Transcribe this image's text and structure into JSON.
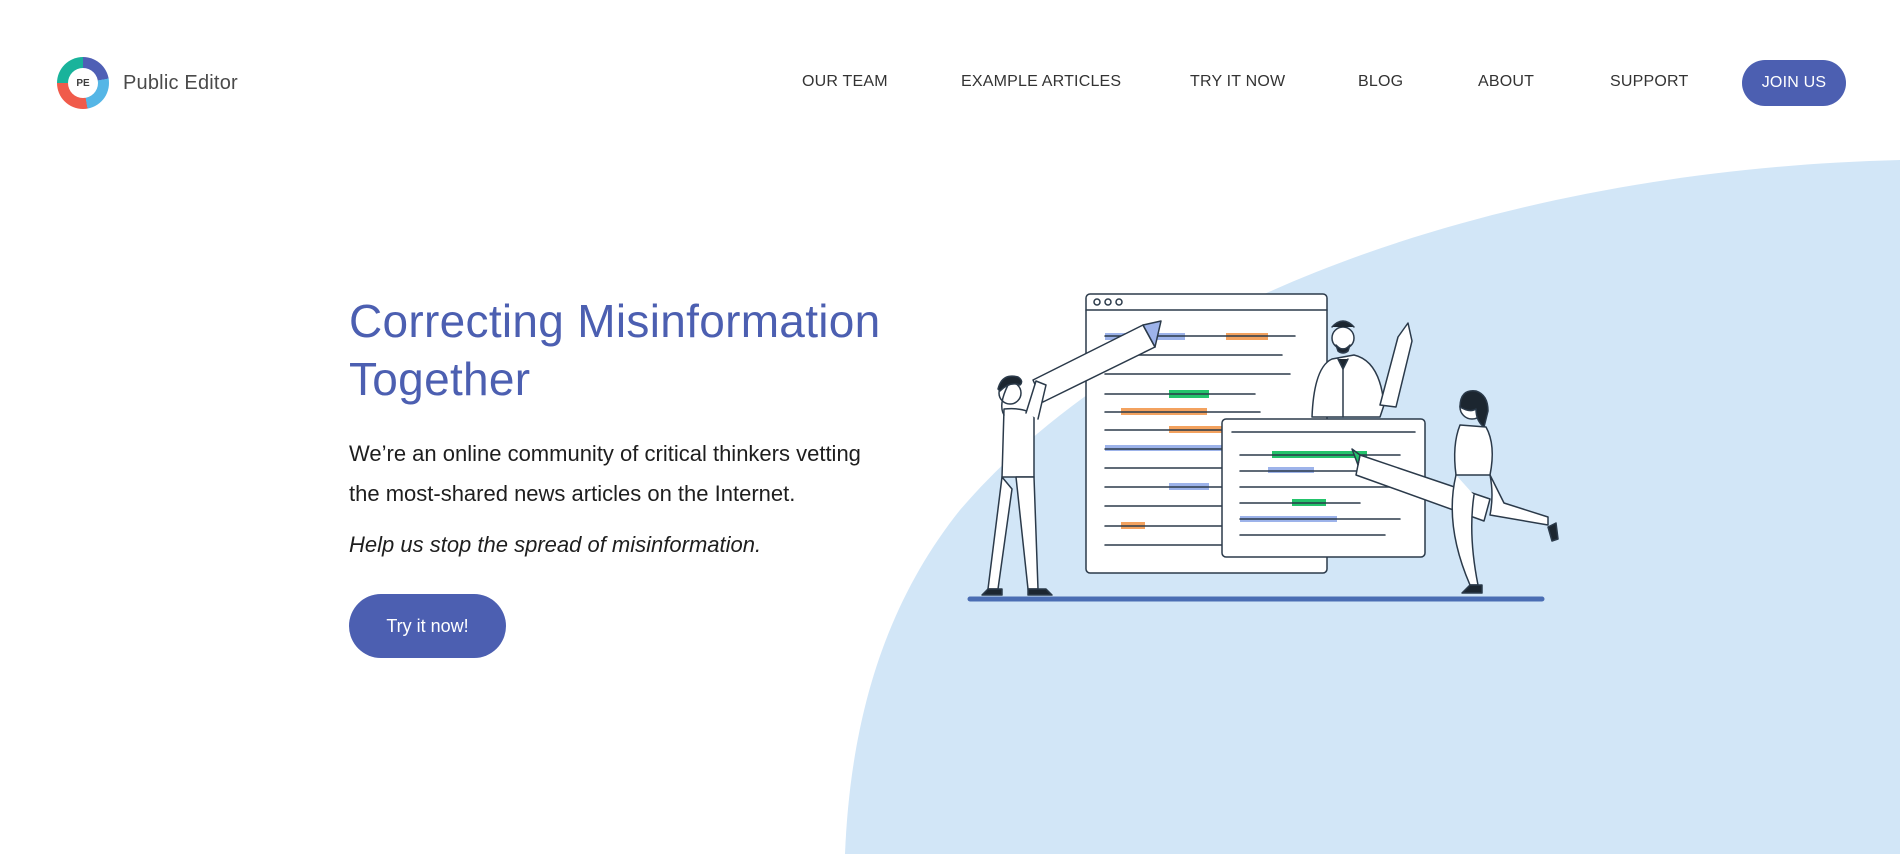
{
  "brand": {
    "logo_initials": "PE",
    "name": "Public Editor"
  },
  "nav": {
    "items": [
      {
        "label": "OUR TEAM"
      },
      {
        "label": "EXAMPLE ARTICLES"
      },
      {
        "label": "TRY IT NOW"
      },
      {
        "label": "BLOG"
      },
      {
        "label": "ABOUT"
      },
      {
        "label": "SUPPORT"
      }
    ],
    "join_label": "JOIN US"
  },
  "hero": {
    "title_line1": "Correcting Misinformation",
    "title_line2": "Together",
    "description": "We’re an online community of critical thinkers vetting the most-shared news articles on the Internet.",
    "tagline": "Help us stop the spread of misinformation.",
    "cta_label": "Try it now!"
  },
  "colors": {
    "accent": "#4c5fb1",
    "blob": "#d2e6f7",
    "highlight_blue": "#9db3ea",
    "highlight_orange": "#f3a25f",
    "highlight_green": "#23c36b"
  },
  "icons": {
    "logo": "public-editor-logo-icon",
    "illustration": "people-highlighting-documents-illustration"
  }
}
